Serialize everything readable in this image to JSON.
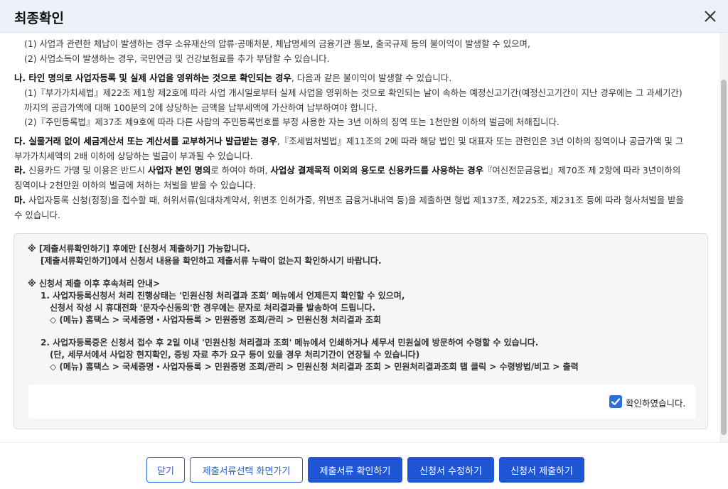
{
  "dialog": {
    "title": "최종확인",
    "close_icon": "close-icon"
  },
  "content": {
    "lines": [
      {
        "parts": [
          {
            "t": "(1) 사업과 관련한 체납이 발생하는 경우 소유재산의 압류·공매처분, 체납명세의 금융기관 통보, 출국규제 등의 불이익이 발생할 수 있으며,",
            "b": false
          }
        ]
      },
      {
        "parts": [
          {
            "t": "(2) 사업소득이 발생하는 경우, 국민연금 및 건강보험료를 추가 부담할 수 있습니다.",
            "b": false
          }
        ]
      },
      {
        "parts": [
          {
            "t": "나. 타인 명의로 사업자등록 및 실제 사업을 영위하는 것으로 확인되는 경우",
            "b": true
          },
          {
            "t": ", 다음과 같은 불이익이 발생할 수 있습니다.",
            "b": false
          }
        ]
      },
      {
        "parts": [
          {
            "t": "(1)『부가가치세법』제22조 제1항 제2호에 따라 사업 개시일로부터 실제 사업을 영위하는 것으로 확인되는 날이 속하는 예정신고기간(예정신고기간이 지난 경우에는 그 과세기간)",
            "b": false
          }
        ]
      },
      {
        "parts": [
          {
            "t": "까지의 공급가액에 대해 100분의 2에 상당하는 금액을 납부세액에 가산하여 납부하여야 합니다.",
            "b": false
          }
        ]
      },
      {
        "parts": [
          {
            "t": "(2)『주민등록법』제37조 제9호에 따라 다른 사람의 주민등록번호를 부정 사용한 자는 3년 이하의 징역 또는 1천만원 이하의 벌금에 처해집니다.",
            "b": false
          }
        ]
      },
      {
        "parts": [
          {
            "t": "다. 실물거래 없이 세금계산서 또는 계산서를 교부하거나 발급받는 경우",
            "b": true
          },
          {
            "t": ",『조세범처벌법』제11조의 2에 따라 해당 법인 및 대표자 또는 관련인은 3년 이하의 징역이나 공급가액 및 그",
            "b": false
          }
        ]
      },
      {
        "parts": [
          {
            "t": "부가가치세액의 2배 이하에 상당하는 벌금이 부과될 수 있습니다.",
            "b": false
          }
        ]
      },
      {
        "parts": [
          {
            "t": "라.",
            "b": true
          },
          {
            "t": " 신용카드 가맹 및 이용은 반드시 ",
            "b": false
          },
          {
            "t": "사업자 본인 명의",
            "b": true
          },
          {
            "t": "로 하여야 하며, ",
            "b": false
          },
          {
            "t": "사업상 결제목적 이외의 용도로 신용카드를 사용하는 경우",
            "b": true
          },
          {
            "t": "『여신전문금융법』제70조 제 2항에 따라 3년이하의",
            "b": false
          }
        ]
      },
      {
        "parts": [
          {
            "t": "징역이나 2천만원 이하의 벌금에 처하는 처벌을 받을 수 있습니다.",
            "b": false
          }
        ]
      },
      {
        "parts": [
          {
            "t": "마.",
            "b": true
          },
          {
            "t": " 사업자등록 신청(정정)을 접수할 때, 허위서류(임대차계약서, 위변조 인허가증, 위변조 금융거내내역 등)을 제출하면 형법 제137조, 제225조, 제231조 등에 따라 형사처벌을 받을",
            "b": false
          }
        ]
      },
      {
        "parts": [
          {
            "t": "수 있습니다.",
            "b": false
          }
        ]
      }
    ]
  },
  "notice": {
    "lines": [
      "※ [제출서류확인하기] 후에만 [신청서 제출하기] 가능합니다.",
      "[제출서류확인하기]에서 신청서 내용을 확인하고 제출서류 누락이 없는지 확인하시기 바랍니다.",
      "※ 신청서 제출 이후 후속처리 안내>",
      "1.  사업자등록신청서 처리 진행상태는 '민원신청 처리결과 조회' 메뉴에서 언제든지 확인할 수 있으며,",
      "신청서 작성 시 휴대전화 '문자수신동의'한 경우에는 문자로 처리결과를 발송하여 드립니다.",
      "◇ (메뉴) 홈택스 > 국세증명・사업자등록 > 민원증명 조회/관리 > 민원신청 처리결과 조회",
      "2.  사업자등록증은 신청서 접수 후 2일 이내 '민원신청 처리결과 조회' 메뉴에서 인쇄하거나 세무서 민원실에 방문하여 수령할 수 있습니다.",
      "(단, 세무서에서 사업장 현지확인, 증빙 자료 추가 요구 등이 있을 경우 처리기간이 연장될 수 있습니다)",
      "◇ (메뉴) 홈택스 > 국세증명・사업자등록 > 민원증명 조회/관리 > 민원신청 처리결과 조회 > 민원처리결과조회 탭 클릭 > 수령방법/비고 > 출력"
    ],
    "confirm_label": "확인하였습니다.",
    "confirm_checked": true
  },
  "footer": {
    "close_label": "닫기",
    "back_label": "제출서류선택 화면가기",
    "check_docs_label": "제출서류 확인하기",
    "edit_label": "신청서 수정하기",
    "submit_label": "신청서 제출하기"
  },
  "colors": {
    "header_bg": "#edf2fa",
    "primary": "#1f56d6",
    "checkbox": "#2b6fd8"
  }
}
